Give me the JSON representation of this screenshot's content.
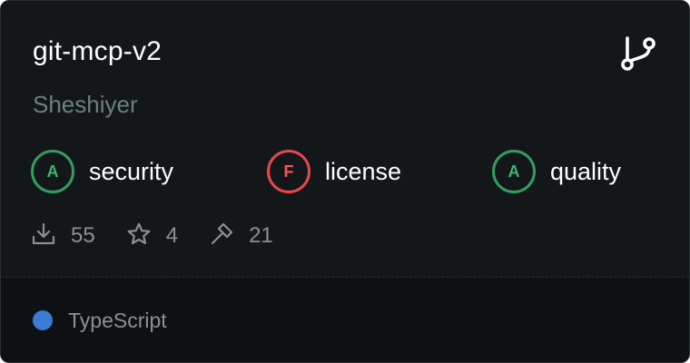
{
  "repo": {
    "name": "git-mcp-v2",
    "owner": "Sheshiyer"
  },
  "icons": {
    "branch": "git-branch-icon",
    "downloads": "download-icon",
    "stars": "star-icon",
    "tools": "hammer-icon"
  },
  "grades": [
    {
      "letter": "A",
      "label": "security",
      "color": "#2f9e5f",
      "text_color": "#3fb370"
    },
    {
      "letter": "F",
      "label": "license",
      "color": "#e5484d",
      "text_color": "#ef5a5e"
    },
    {
      "letter": "A",
      "label": "quality",
      "color": "#2f9e5f",
      "text_color": "#3fb370"
    }
  ],
  "stats": {
    "downloads": "55",
    "stars": "4",
    "tools": "21"
  },
  "language": {
    "name": "TypeScript",
    "color": "#3178c6"
  },
  "colors": {
    "card_bg": "#131719",
    "footer_bg": "#0e1113",
    "owner_text": "#6a8378",
    "muted_text": "#8a9094"
  }
}
